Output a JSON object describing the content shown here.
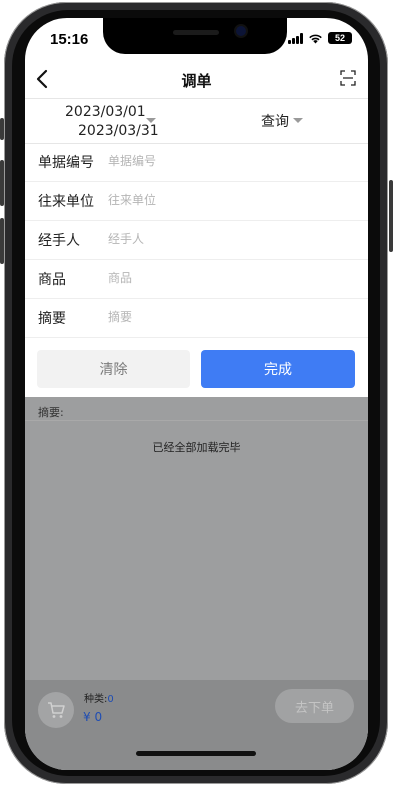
{
  "status_bar": {
    "time": "15:16",
    "battery": "52"
  },
  "nav": {
    "title": "调单"
  },
  "date_filter": {
    "start": "2023/03/01",
    "end": "2023/03/31",
    "query_label": "查询"
  },
  "form": {
    "rows": [
      {
        "label": "单据编号",
        "placeholder": "单据编号"
      },
      {
        "label": "往来单位",
        "placeholder": "往来单位"
      },
      {
        "label": "经手人",
        "placeholder": "经手人"
      },
      {
        "label": "商品",
        "placeholder": "商品"
      },
      {
        "label": "摘要",
        "placeholder": "摘要"
      }
    ],
    "clear_label": "清除",
    "done_label": "完成"
  },
  "list": {
    "summary_label": "摘要:",
    "loaded_text": "已经全部加载完毕"
  },
  "bottom_bar": {
    "kind_label": "种类:",
    "kind_count": "0",
    "price": "¥ 0",
    "order_label": "去下单"
  },
  "colors": {
    "primary": "#3f7cf4",
    "overlay": "#9d9e9f",
    "accent_text": "#1f4db3"
  },
  "icons": {
    "back": "chevron-left-icon",
    "scan": "scan-icon",
    "cart": "cart-icon"
  }
}
